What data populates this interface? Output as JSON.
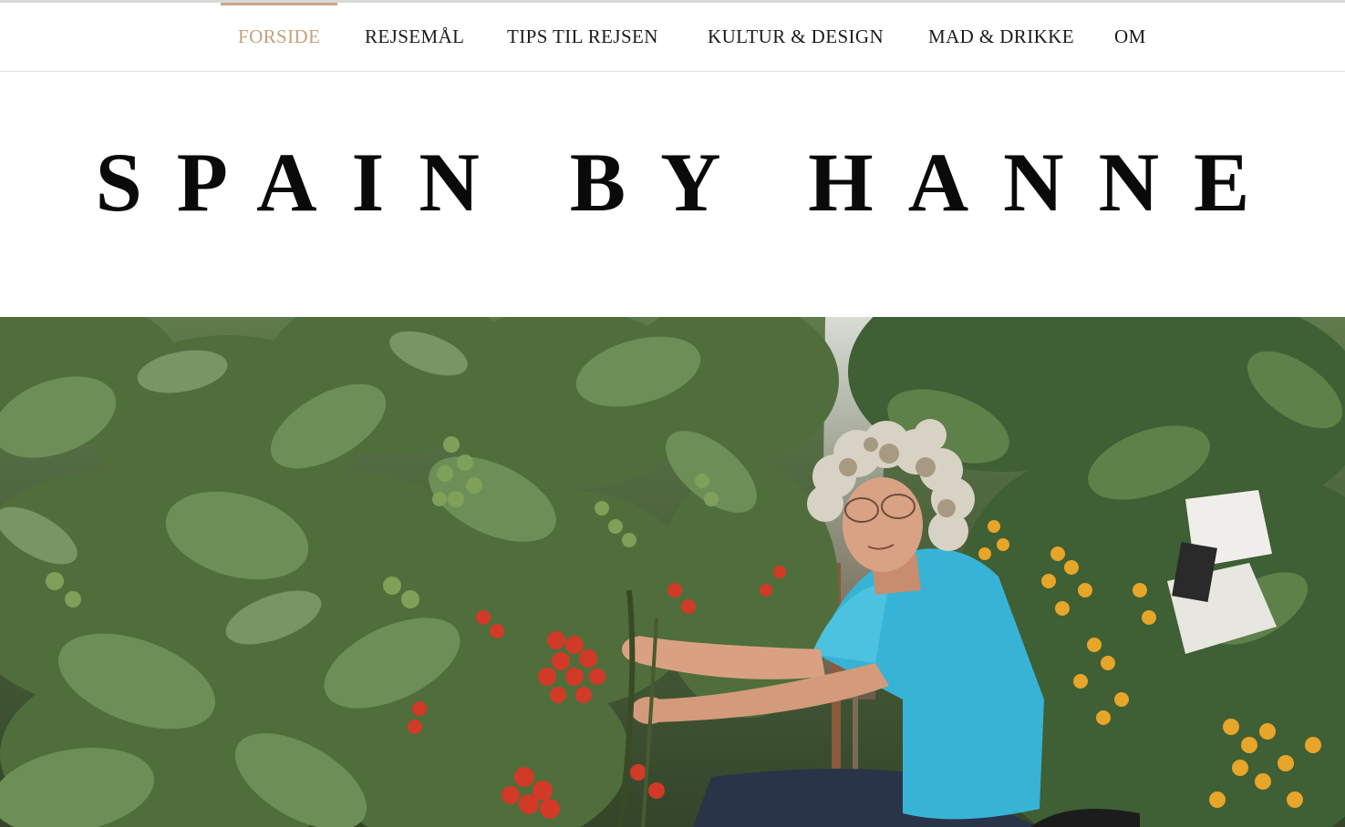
{
  "nav": {
    "items": [
      {
        "label": "FORSIDE",
        "active": true
      },
      {
        "label": "REJSEMÅL",
        "active": false
      },
      {
        "label": "TIPS TIL REJSEN",
        "active": false
      },
      {
        "label": "KULTUR & DESIGN",
        "active": false
      },
      {
        "label": "MAD & DRIKKE",
        "active": false
      },
      {
        "label": "OM",
        "active": false
      }
    ]
  },
  "site": {
    "title": "SPAIN BY HANNE"
  },
  "colors": {
    "accent": "#c4a27a",
    "text": "#1b1b1b",
    "shirt": "#37b3d6"
  },
  "hero": {
    "image": "woman-in-tomato-greenhouse-photo"
  }
}
